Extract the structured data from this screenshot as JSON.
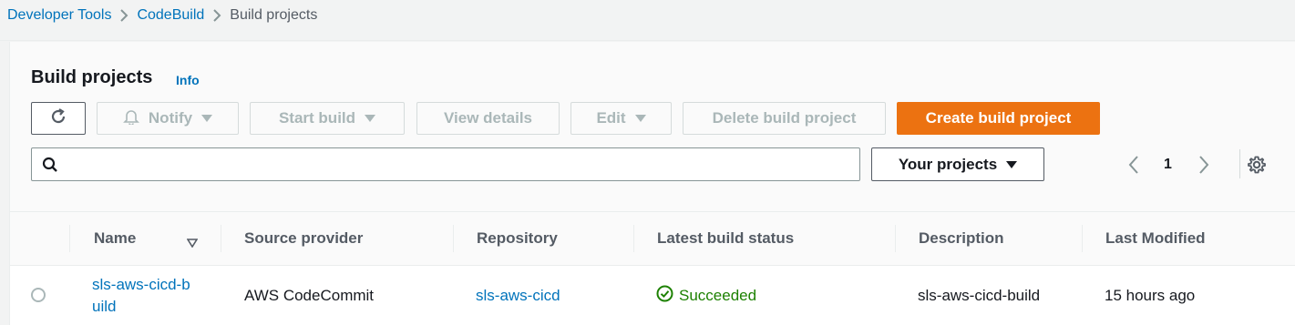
{
  "breadcrumb": {
    "items": [
      "Developer Tools",
      "CodeBuild"
    ],
    "current": "Build projects"
  },
  "header": {
    "title": "Build projects",
    "info": "Info"
  },
  "toolbar": {
    "notify": "Notify",
    "start_build": "Start build",
    "view_details": "View details",
    "edit": "Edit",
    "delete": "Delete build project",
    "create": "Create build project"
  },
  "search": {
    "value": "",
    "placeholder": ""
  },
  "filter": {
    "selected": "Your projects"
  },
  "pagination": {
    "page": "1"
  },
  "table": {
    "columns": [
      "Name",
      "Source provider",
      "Repository",
      "Latest build status",
      "Description",
      "Last Modified"
    ],
    "rows": [
      {
        "name": "sls-aws-cicd-build",
        "source_provider": "AWS CodeCommit",
        "repository": "sls-aws-cicd",
        "status": "Succeeded",
        "description": "sls-aws-cicd-build",
        "last_modified": "15 hours ago"
      }
    ]
  },
  "colors": {
    "link": "#0073bb",
    "primary": "#ec7211",
    "success": "#1d8102"
  },
  "icons": [
    "chevron-right-icon",
    "refresh-icon",
    "bell-icon",
    "caret-down-icon",
    "search-icon",
    "chevron-left-icon",
    "gear-icon",
    "sort-down-icon",
    "check-circle-icon"
  ]
}
